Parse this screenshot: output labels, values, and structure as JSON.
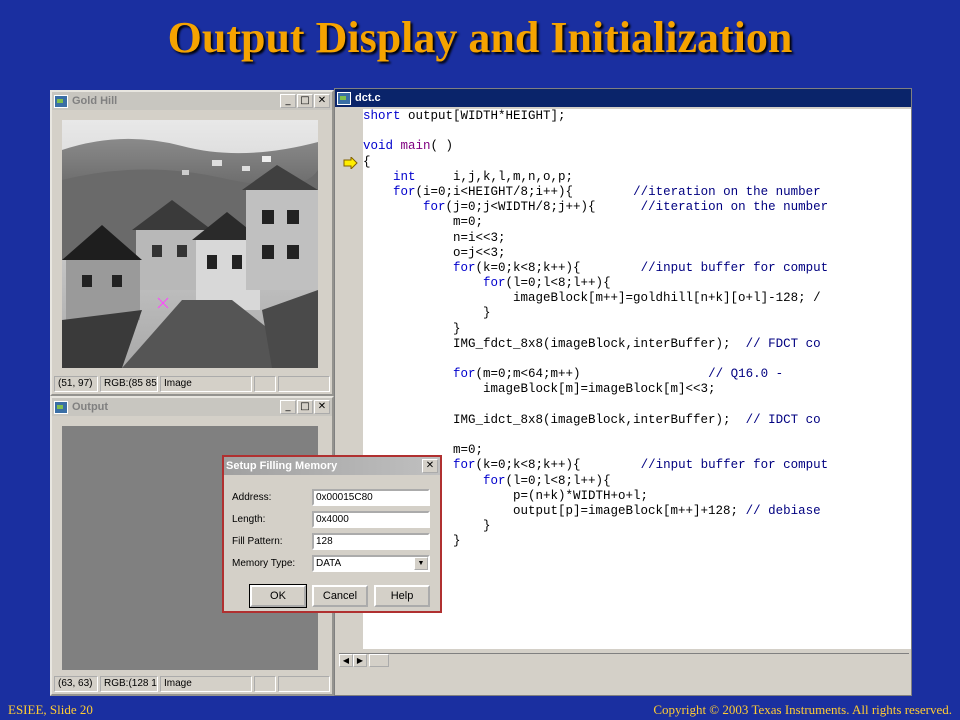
{
  "slide": {
    "title": "Output Display and Initialization",
    "footer_left": "ESIEE, Slide 20",
    "footer_right": "Copyright © 2003 Texas Instruments. All rights reserved."
  },
  "windows": {
    "goldhill": {
      "title": "Gold Hill",
      "status_coords": "(51, 97)",
      "status_rgb": "RGB:(85 85",
      "status_type": "Image"
    },
    "output": {
      "title": "Output",
      "status_coords": "(63, 63)",
      "status_rgb": "RGB:(128 1",
      "status_type": "Image"
    },
    "editor": {
      "title": "dct.c",
      "lines": [
        "short output[WIDTH*HEIGHT];",
        "",
        "void main( )",
        "{",
        "    int     i,j,k,l,m,n,o,p;",
        "    for(i=0;i<HEIGHT/8;i++){        //iteration on the number",
        "        for(j=0;j<WIDTH/8;j++){      //iteration on the number",
        "            m=0;",
        "            n=i<<3;",
        "            o=j<<3;",
        "            for(k=0;k<8;k++){        //input buffer for comput",
        "                for(l=0;l<8;l++){",
        "                    imageBlock[m++]=goldhill[n+k][o+l]-128; /",
        "                }",
        "            }",
        "            IMG_fdct_8x8(imageBlock,interBuffer);  // FDCT co",
        "",
        "            for(m=0;m<64;m++)                 // Q16.0 -",
        "                imageBlock[m]=imageBlock[m]<<3;",
        "",
        "            IMG_idct_8x8(imageBlock,interBuffer);  // IDCT co",
        "",
        "            m=0;",
        "            for(k=0;k<8;k++){        //input buffer for comput",
        "                for(l=0;l<8;l++){",
        "                    p=(n+k)*WIDTH+o+l;",
        "                    output[p]=imageBlock[m++]+128; // debiase",
        "                }",
        "            }"
      ]
    }
  },
  "dialog": {
    "title": "Setup Filling Memory",
    "address_label": "Address:",
    "address_value": "0x00015C80",
    "length_label": "Length:",
    "length_value": "0x4000",
    "pattern_label": "Fill Pattern:",
    "pattern_value": "128",
    "memtype_label": "Memory Type:",
    "memtype_value": "DATA",
    "ok_label": "OK",
    "cancel_label": "Cancel",
    "help_label": "Help"
  },
  "colors": {
    "background": "#1a2fa0",
    "title": "#f5a300",
    "keyword": "#0000cc"
  }
}
